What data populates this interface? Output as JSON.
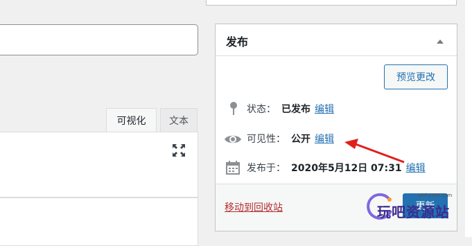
{
  "editor": {
    "tabs": [
      {
        "label": "可视化"
      },
      {
        "label": "文本"
      }
    ]
  },
  "publish": {
    "title": "发布",
    "preview_button": "预览更改",
    "status": {
      "label": "状态：",
      "value": "已发布",
      "edit": "编辑"
    },
    "visibility": {
      "label": "可见性：",
      "value": "公开",
      "edit": "编辑"
    },
    "published_on": {
      "label": "发布于：",
      "value": "2020年5月12日 07:31",
      "edit": "编辑"
    },
    "trash_link": "移动到回收站",
    "update_button": "更新"
  },
  "watermark": {
    "url": "wbhy365.com",
    "text": "玩吧资源站"
  },
  "colors": {
    "accent": "#2271b1",
    "danger": "#b32d2e",
    "arrow": "#e0201b"
  },
  "icons": {
    "fullscreen": "fullscreen-icon",
    "collapse": "triangle-up-icon",
    "status": "pin-icon",
    "visibility": "eye-icon",
    "date": "calendar-icon"
  }
}
